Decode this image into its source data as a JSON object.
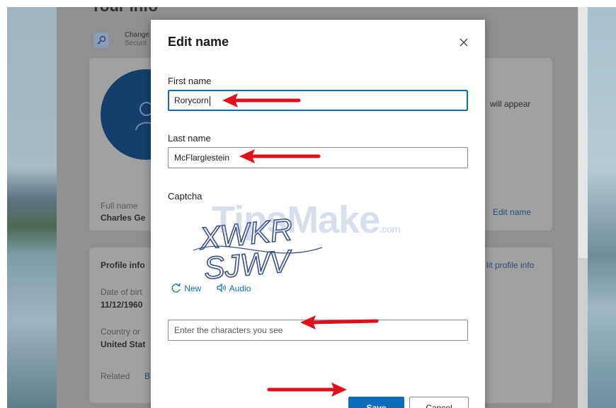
{
  "background": {
    "page_title": "Your info",
    "security_card": {
      "title": "Change",
      "subtitle": "Securit"
    },
    "profile_card": {
      "appear_text": "will appear",
      "full_name_label": "Full name",
      "full_name_value": "Charles Ge",
      "edit_name_link": "Edit name"
    },
    "info_card": {
      "title": "Profile info",
      "edit_link": "lit profile info",
      "dob_label": "Date of birt",
      "dob_value": "11/12/1960",
      "country_label": "Country or",
      "country_value": "United Stat",
      "related_label": "Related",
      "related_link": "B"
    }
  },
  "dialog": {
    "title": "Edit name",
    "first_name": {
      "label": "First name",
      "value": "Rorycorn"
    },
    "last_name": {
      "label": "Last name",
      "value": "McFlarglestein"
    },
    "captcha": {
      "label": "Captcha",
      "image_text_line1": "XWKR",
      "image_text_line2": "SJWV",
      "new_label": "New",
      "audio_label": "Audio",
      "input_placeholder": "Enter the characters you see"
    },
    "save_label": "Save",
    "cancel_label": "Cancel"
  },
  "watermark": {
    "text": "TipsMake",
    "suffix": ".com"
  },
  "colors": {
    "accent": "#0f6cbd",
    "arrow": "#e0101a",
    "overlay": "#8f8f8f"
  },
  "icons": [
    "close-icon",
    "refresh-icon",
    "speaker-icon",
    "key-icon",
    "person-icon"
  ]
}
